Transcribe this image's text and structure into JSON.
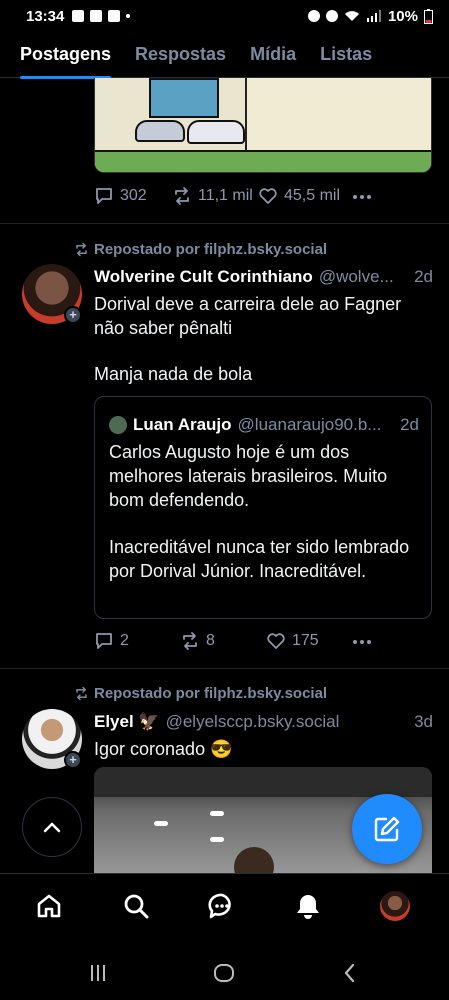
{
  "status_bar": {
    "time": "13:34",
    "battery": "10%"
  },
  "tabs": [
    {
      "label": "Postagens",
      "active": true
    },
    {
      "label": "Respostas",
      "active": false
    },
    {
      "label": "Mídia",
      "active": false
    },
    {
      "label": "Listas",
      "active": false
    }
  ],
  "posts": [
    {
      "replies": "302",
      "reposts": "11,1 mil",
      "likes": "45,5 mil"
    },
    {
      "repost_label": "Repostado por filphz.bsky.social",
      "author_name": "Wolverine Cult Corinthiano",
      "author_handle": "@wolve...",
      "age": "2d",
      "text_1": "Dorival deve a carreira dele ao Fagner não saber pênalti",
      "text_2": "Manja nada de bola",
      "quote": {
        "author_name": "Luan Araujo",
        "author_handle": "@luanaraujo90.b...",
        "age": "2d",
        "text_1": "Carlos Augusto hoje é um dos melhores laterais brasileiros. Muito bom defendendo.",
        "text_2": "Inacreditável nunca ter sido lembrado por Dorival Júnior. Inacreditável."
      },
      "replies": "2",
      "reposts": "8",
      "likes": "175"
    },
    {
      "repost_label": "Repostado por filphz.bsky.social",
      "author_name": "Elyel 🦅",
      "author_handle": "@elyelsccp.bsky.social",
      "age": "3d",
      "text_1": "Igor coronado 😎"
    }
  ],
  "colors": {
    "accent": "#208bfe",
    "muted": "#7d8ba0",
    "background": "#000000"
  },
  "icons": {
    "nav": [
      "home-icon",
      "search-icon",
      "chat-icon",
      "notifications-icon",
      "profile-avatar"
    ],
    "fab": "compose-icon",
    "scroll": "chevron-up-icon"
  }
}
